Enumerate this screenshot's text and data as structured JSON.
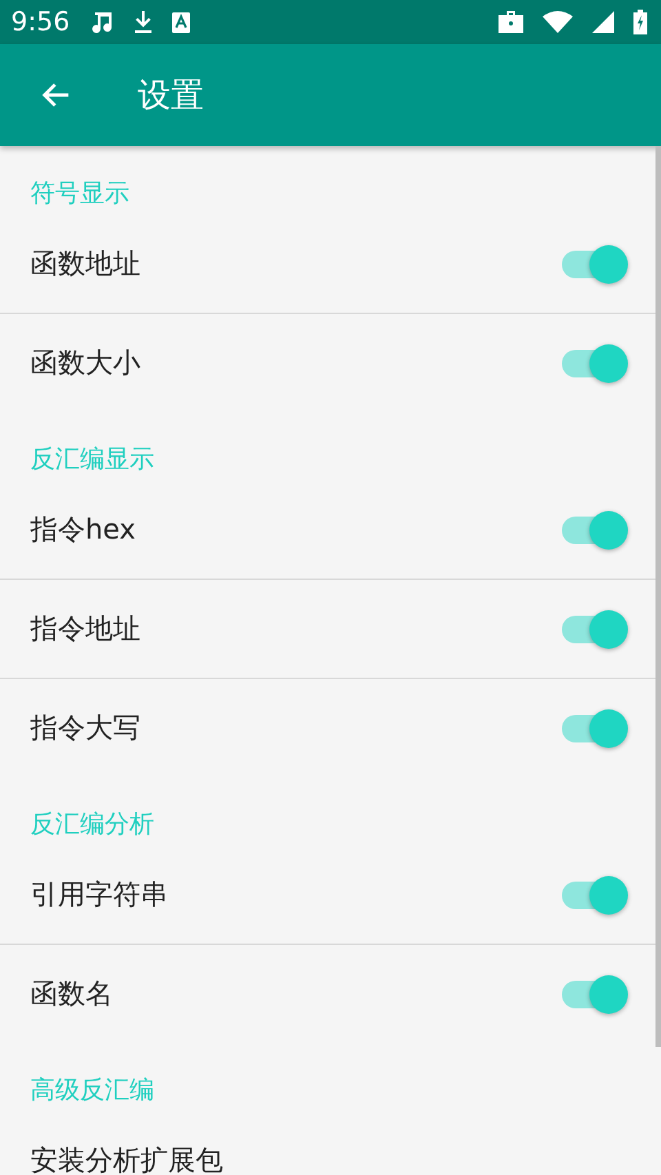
{
  "status_bar": {
    "time": "9:56"
  },
  "app_bar": {
    "title": "设置"
  },
  "sections": [
    {
      "header": "符号显示",
      "items": [
        {
          "kind": "switch",
          "label": "函数地址",
          "on": true
        },
        {
          "kind": "switch",
          "label": "函数大小",
          "on": true
        }
      ]
    },
    {
      "header": "反汇编显示",
      "items": [
        {
          "kind": "switch",
          "label": "指令hex",
          "on": true
        },
        {
          "kind": "switch",
          "label": "指令地址",
          "on": true
        },
        {
          "kind": "switch",
          "label": "指令大写",
          "on": true
        }
      ]
    },
    {
      "header": "反汇编分析",
      "items": [
        {
          "kind": "switch",
          "label": "引用字符串",
          "on": true
        },
        {
          "kind": "switch",
          "label": "函数名",
          "on": true
        }
      ]
    },
    {
      "header": "高级反汇编",
      "items": [
        {
          "kind": "action",
          "label": "安装分析扩展包"
        }
      ]
    }
  ]
}
